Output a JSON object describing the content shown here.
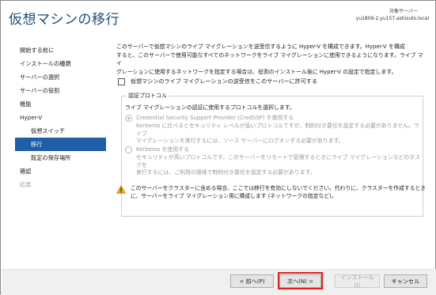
{
  "window": {
    "title": "仮想マシンの移行",
    "target_label": "対象サーバー",
    "target_host": "yu1809-2.yu157.ashisuto.local"
  },
  "sidebar": {
    "items": [
      {
        "label": "開始する前に",
        "state": "normal"
      },
      {
        "label": "インストールの種類",
        "state": "normal"
      },
      {
        "label": "サーバーの選択",
        "state": "normal"
      },
      {
        "label": "サーバーの役割",
        "state": "normal"
      },
      {
        "label": "機能",
        "state": "normal"
      },
      {
        "label": "Hyper-V",
        "state": "normal"
      },
      {
        "label": "仮想スイッチ",
        "state": "sub"
      },
      {
        "label": "移行",
        "state": "selected"
      },
      {
        "label": "既定の保存場所",
        "state": "sub"
      },
      {
        "label": "確認",
        "state": "normal"
      },
      {
        "label": "結果",
        "state": "disabled"
      }
    ]
  },
  "main": {
    "intro_lines": [
      "このサーバーで仮想マシンのライブ マイグレーションを送受信するように Hyper-V を構成できます。Hyper-V を構成",
      "すると、このサーバーで使用可能なすべてのネットワークをライブ マイグレーションに使用できるようになります。ライブ マイ",
      "グレーションに使用するネットワークを指定する場合は、役割のインストール後に Hyper-V の設定で指定します。"
    ],
    "checkbox": {
      "label": "仮想マシンのライブ マイグレーションの送受信をこのサーバーに許可する",
      "checked": false
    },
    "auth_group": {
      "legend": "認証プロトコル",
      "description": "ライブ マイグレーションの認証に使用するプロトコルを選択します。",
      "options": [
        {
          "label": "Credential Security Support Provider (CredSSP) を使用する",
          "desc_lines": [
            "Kerberos に比べるとセキュリティ レベルが低いプロトコルですが、制約付き委任を設定する必要がありません。ライブ",
            "マイグレーションを実行するには、ソース サーバーにログオンする必要があります。"
          ],
          "selected": true
        },
        {
          "label": "Kerberos を使用する",
          "desc_lines": [
            "セキュリティが高いプロトコルです。このサーバーをリモートで管理するときにライブ マイグレーションなどのタスクを",
            "実行するには、ご利用の環境で制約付き委任を設定する必要があります。"
          ],
          "selected": false
        }
      ]
    },
    "warning": {
      "icon": "warning-icon",
      "lines": [
        "このサーバーをクラスターに含める場合、ここでは移行を有効にしないでください。代わりに、クラスターを作成するとき",
        "に、サーバーをライブ マイグレーション用に構成します (ネットワークの指定など)。"
      ]
    }
  },
  "footer": {
    "prev_label": "< 前へ(P)",
    "next_label": "次へ(N) >",
    "install_label": "インストール(I)",
    "cancel_label": "キャンセル"
  },
  "colors": {
    "title": "#1f4e79",
    "selected_bg": "#1f5fa7",
    "highlight": "#e02020",
    "warning": "#e8a317"
  }
}
